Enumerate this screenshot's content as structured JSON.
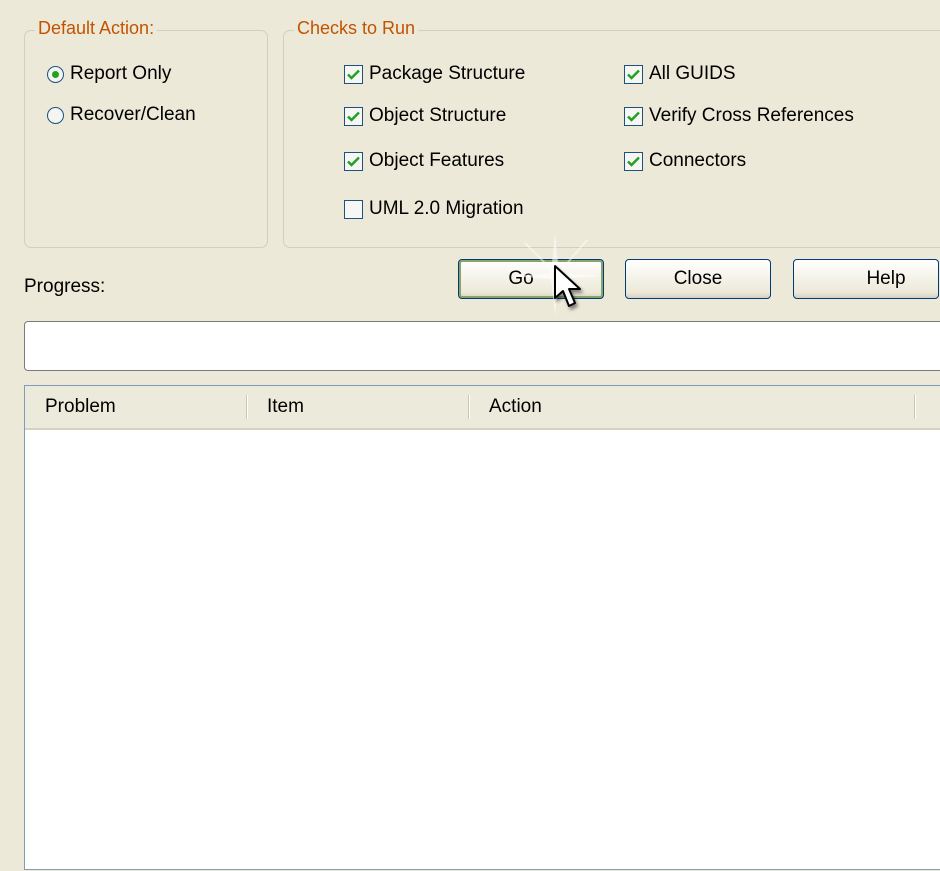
{
  "default_action": {
    "legend": "Default Action:",
    "options": [
      {
        "label": "Report Only",
        "selected": true
      },
      {
        "label": "Recover/Clean",
        "selected": false
      }
    ]
  },
  "checks": {
    "legend": "Checks to Run",
    "items": [
      {
        "label": "Package Structure",
        "checked": true
      },
      {
        "label": "Object Structure",
        "checked": true
      },
      {
        "label": "Object Features",
        "checked": true
      },
      {
        "label": "UML 2.0 Migration",
        "checked": false
      },
      {
        "label": "All GUIDS",
        "checked": true
      },
      {
        "label": "Verify Cross References",
        "checked": true
      },
      {
        "label": "Connectors",
        "checked": true
      }
    ]
  },
  "progress": {
    "label": "Progress:"
  },
  "buttons": {
    "go": "Go",
    "close": "Close",
    "help": "Help"
  },
  "list": {
    "columns": [
      "Problem",
      "Item",
      "Action"
    ],
    "rows": []
  },
  "colors": {
    "accent_green": "#21a121",
    "legend_orange": "#c25400",
    "face": "#ece9d8"
  }
}
